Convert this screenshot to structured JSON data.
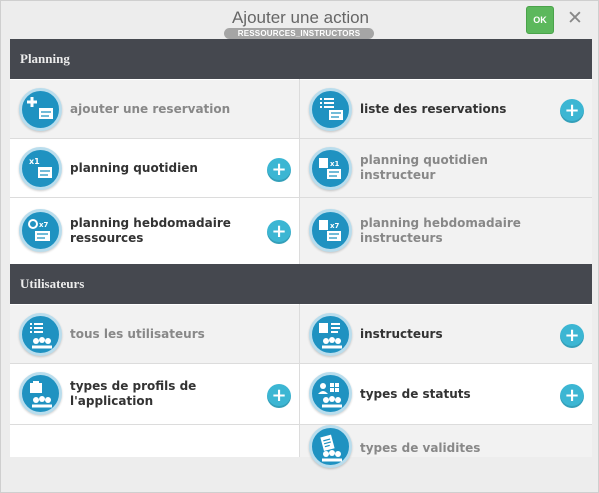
{
  "dialog": {
    "title": "Ajouter une action",
    "subtitle": "RESSOURCES_INSTRUCTORS",
    "ok_label": "OK",
    "close_label": "✕"
  },
  "sections": [
    {
      "header": "Planning",
      "tiles": [
        {
          "label": "ajouter une reservation",
          "muted": true,
          "plus": false,
          "icon": "add-reservation-icon"
        },
        {
          "label": "liste des reservations",
          "muted": false,
          "plus": true,
          "icon": "list-reservations-icon"
        },
        {
          "label": "planning quotidien",
          "muted": false,
          "plus": true,
          "icon": "daily-planning-icon"
        },
        {
          "label": "planning quotidien instructeur",
          "muted": true,
          "plus": false,
          "icon": "daily-instructor-planning-icon"
        },
        {
          "label": "planning hebdomadaire ressources",
          "muted": false,
          "plus": true,
          "icon": "weekly-resources-planning-icon"
        },
        {
          "label": "planning hebdomadaire instructeurs",
          "muted": true,
          "plus": false,
          "icon": "weekly-instructors-planning-icon"
        }
      ]
    },
    {
      "header": "Utilisateurs",
      "tiles": [
        {
          "label": "tous les utilisateurs",
          "muted": true,
          "plus": false,
          "icon": "all-users-icon"
        },
        {
          "label": "instructeurs",
          "muted": false,
          "plus": true,
          "icon": "instructors-icon"
        },
        {
          "label": "types de profils de l'application",
          "muted": false,
          "plus": true,
          "icon": "profile-types-icon"
        },
        {
          "label": "types de statuts",
          "muted": false,
          "plus": true,
          "icon": "status-types-icon"
        },
        {
          "label": "types de validites",
          "muted": true,
          "plus": false,
          "icon": "validity-types-icon"
        }
      ]
    }
  ],
  "plus_label": "+",
  "colors": {
    "header_bg": "#45484f",
    "icon_circle": "#1f92c1",
    "plus_button": "#3cb6d3",
    "ok_button": "#5cb85c"
  }
}
